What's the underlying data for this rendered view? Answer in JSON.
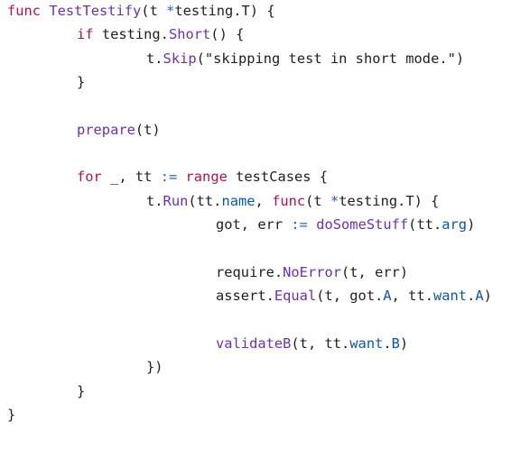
{
  "lines": [
    {
      "indent": 0,
      "tokens": [
        {
          "t": "func",
          "k": "kw"
        },
        {
          "t": " ",
          "k": "id"
        },
        {
          "t": "TestTestify",
          "k": "fn"
        },
        {
          "t": "(t ",
          "k": "id"
        },
        {
          "t": "*",
          "k": "op"
        },
        {
          "t": "testing.T) {",
          "k": "id"
        }
      ]
    },
    {
      "indent": 1,
      "tokens": [
        {
          "t": "if",
          "k": "kw"
        },
        {
          "t": " testing.",
          "k": "id"
        },
        {
          "t": "Short",
          "k": "fn"
        },
        {
          "t": "() {",
          "k": "id"
        }
      ]
    },
    {
      "indent": 2,
      "tokens": [
        {
          "t": "t.",
          "k": "id"
        },
        {
          "t": "Skip",
          "k": "fn"
        },
        {
          "t": "(\"skipping test in short mode.\")",
          "k": "id"
        }
      ]
    },
    {
      "indent": 1,
      "tokens": [
        {
          "t": "}",
          "k": "id"
        }
      ]
    },
    {
      "indent": 0,
      "tokens": []
    },
    {
      "indent": 1,
      "tokens": [
        {
          "t": "prepare",
          "k": "fn"
        },
        {
          "t": "(t)",
          "k": "id"
        }
      ]
    },
    {
      "indent": 0,
      "tokens": []
    },
    {
      "indent": 1,
      "tokens": [
        {
          "t": "for",
          "k": "kw"
        },
        {
          "t": " _, tt ",
          "k": "id"
        },
        {
          "t": ":=",
          "k": "op"
        },
        {
          "t": " ",
          "k": "id"
        },
        {
          "t": "range",
          "k": "kw"
        },
        {
          "t": " testCases {",
          "k": "id"
        }
      ]
    },
    {
      "indent": 2,
      "tokens": [
        {
          "t": "t.",
          "k": "id"
        },
        {
          "t": "Run",
          "k": "fn"
        },
        {
          "t": "(tt.",
          "k": "id"
        },
        {
          "t": "name",
          "k": "fd"
        },
        {
          "t": ", ",
          "k": "id"
        },
        {
          "t": "func",
          "k": "kw"
        },
        {
          "t": "(t ",
          "k": "id"
        },
        {
          "t": "*",
          "k": "op"
        },
        {
          "t": "testing.T) {",
          "k": "id"
        }
      ]
    },
    {
      "indent": 3,
      "tokens": [
        {
          "t": "got, err ",
          "k": "id"
        },
        {
          "t": ":=",
          "k": "op"
        },
        {
          "t": " ",
          "k": "id"
        },
        {
          "t": "doSomeStuff",
          "k": "fn"
        },
        {
          "t": "(tt.",
          "k": "id"
        },
        {
          "t": "arg",
          "k": "fd"
        },
        {
          "t": ")",
          "k": "id"
        }
      ]
    },
    {
      "indent": 0,
      "tokens": []
    },
    {
      "indent": 3,
      "tokens": [
        {
          "t": "require.",
          "k": "id"
        },
        {
          "t": "NoError",
          "k": "fn"
        },
        {
          "t": "(t, err)",
          "k": "id"
        }
      ]
    },
    {
      "indent": 3,
      "tokens": [
        {
          "t": "assert.",
          "k": "id"
        },
        {
          "t": "Equal",
          "k": "fn"
        },
        {
          "t": "(t, got.",
          "k": "id"
        },
        {
          "t": "A",
          "k": "fd"
        },
        {
          "t": ", tt.",
          "k": "id"
        },
        {
          "t": "want",
          "k": "fd"
        },
        {
          "t": ".",
          "k": "id"
        },
        {
          "t": "A",
          "k": "fd"
        },
        {
          "t": ")",
          "k": "id"
        }
      ]
    },
    {
      "indent": 0,
      "tokens": []
    },
    {
      "indent": 3,
      "tokens": [
        {
          "t": "validateB",
          "k": "fn"
        },
        {
          "t": "(t, tt.",
          "k": "id"
        },
        {
          "t": "want",
          "k": "fd"
        },
        {
          "t": ".",
          "k": "id"
        },
        {
          "t": "B",
          "k": "fd"
        },
        {
          "t": ")",
          "k": "id"
        }
      ]
    },
    {
      "indent": 2,
      "tokens": [
        {
          "t": "})",
          "k": "id"
        }
      ]
    },
    {
      "indent": 1,
      "tokens": [
        {
          "t": "}",
          "k": "id"
        }
      ]
    },
    {
      "indent": 0,
      "tokens": [
        {
          "t": "}",
          "k": "id"
        }
      ]
    }
  ],
  "colors": {
    "keyword": "#b4104f",
    "function": "#6d2fb3",
    "field": "#0b57a4",
    "operator": "#2763c4",
    "text": "#1f1f1f",
    "background": "#ffffff"
  }
}
